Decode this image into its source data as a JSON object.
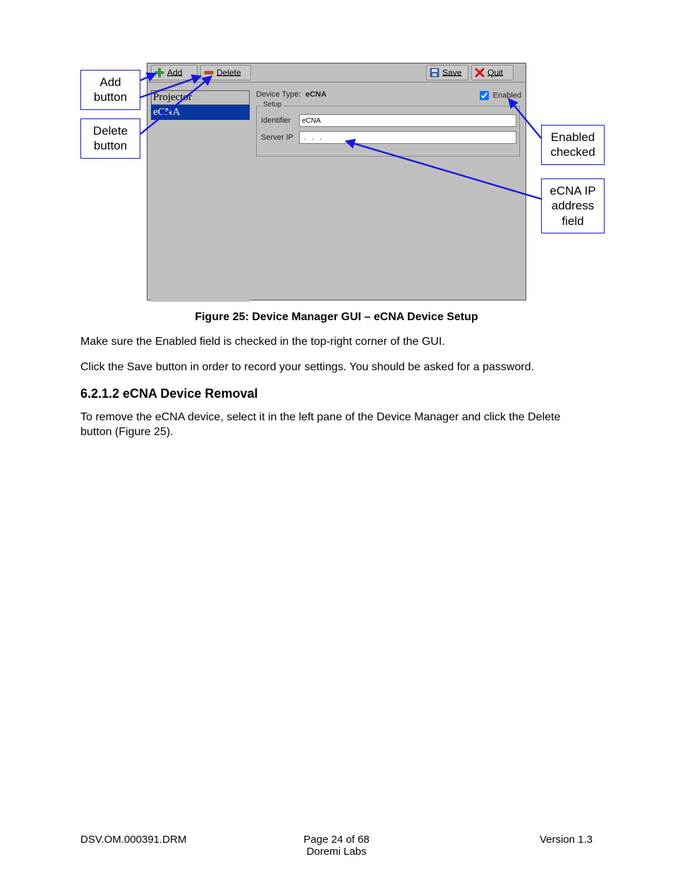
{
  "gui": {
    "toolbar": {
      "add": "Add",
      "delete": "Delete",
      "save": "Save",
      "quit": "Quit"
    },
    "device_list": {
      "items": [
        "Projector",
        "eCNA"
      ],
      "selected_index": 1
    },
    "detail": {
      "device_type_label": "Device Type:",
      "device_type_value": "eCNA",
      "enabled_label": "Enabled",
      "enabled_checked": true,
      "setup_legend": "Setup",
      "identifier_label": "Identifier",
      "identifier_value": "eCNA",
      "server_ip_label": "Server IP",
      "server_ip_value": " .   .   .  "
    }
  },
  "callouts": {
    "add": "Add button",
    "delete": "Delete button",
    "enabled": "Enabled checked",
    "ip": "eCNA IP address field"
  },
  "caption": "Figure 25: Device Manager GUI – eCNA Device Setup",
  "para1": "Make sure the Enabled field is checked in the top-right corner of the GUI.",
  "para2": "Click the Save button in order to record your settings. You should be asked for a password.",
  "heading": "6.2.1.2  eCNA Device Removal",
  "para3": "To remove the eCNA device, select it in the left pane of the Device Manager and click the Delete button (Figure 25).",
  "footer": {
    "left": "DSV.OM.000391.DRM",
    "center_line1": "Page 24 of 68",
    "center_line2": "Doremi Labs",
    "right": "Version 1.3"
  }
}
